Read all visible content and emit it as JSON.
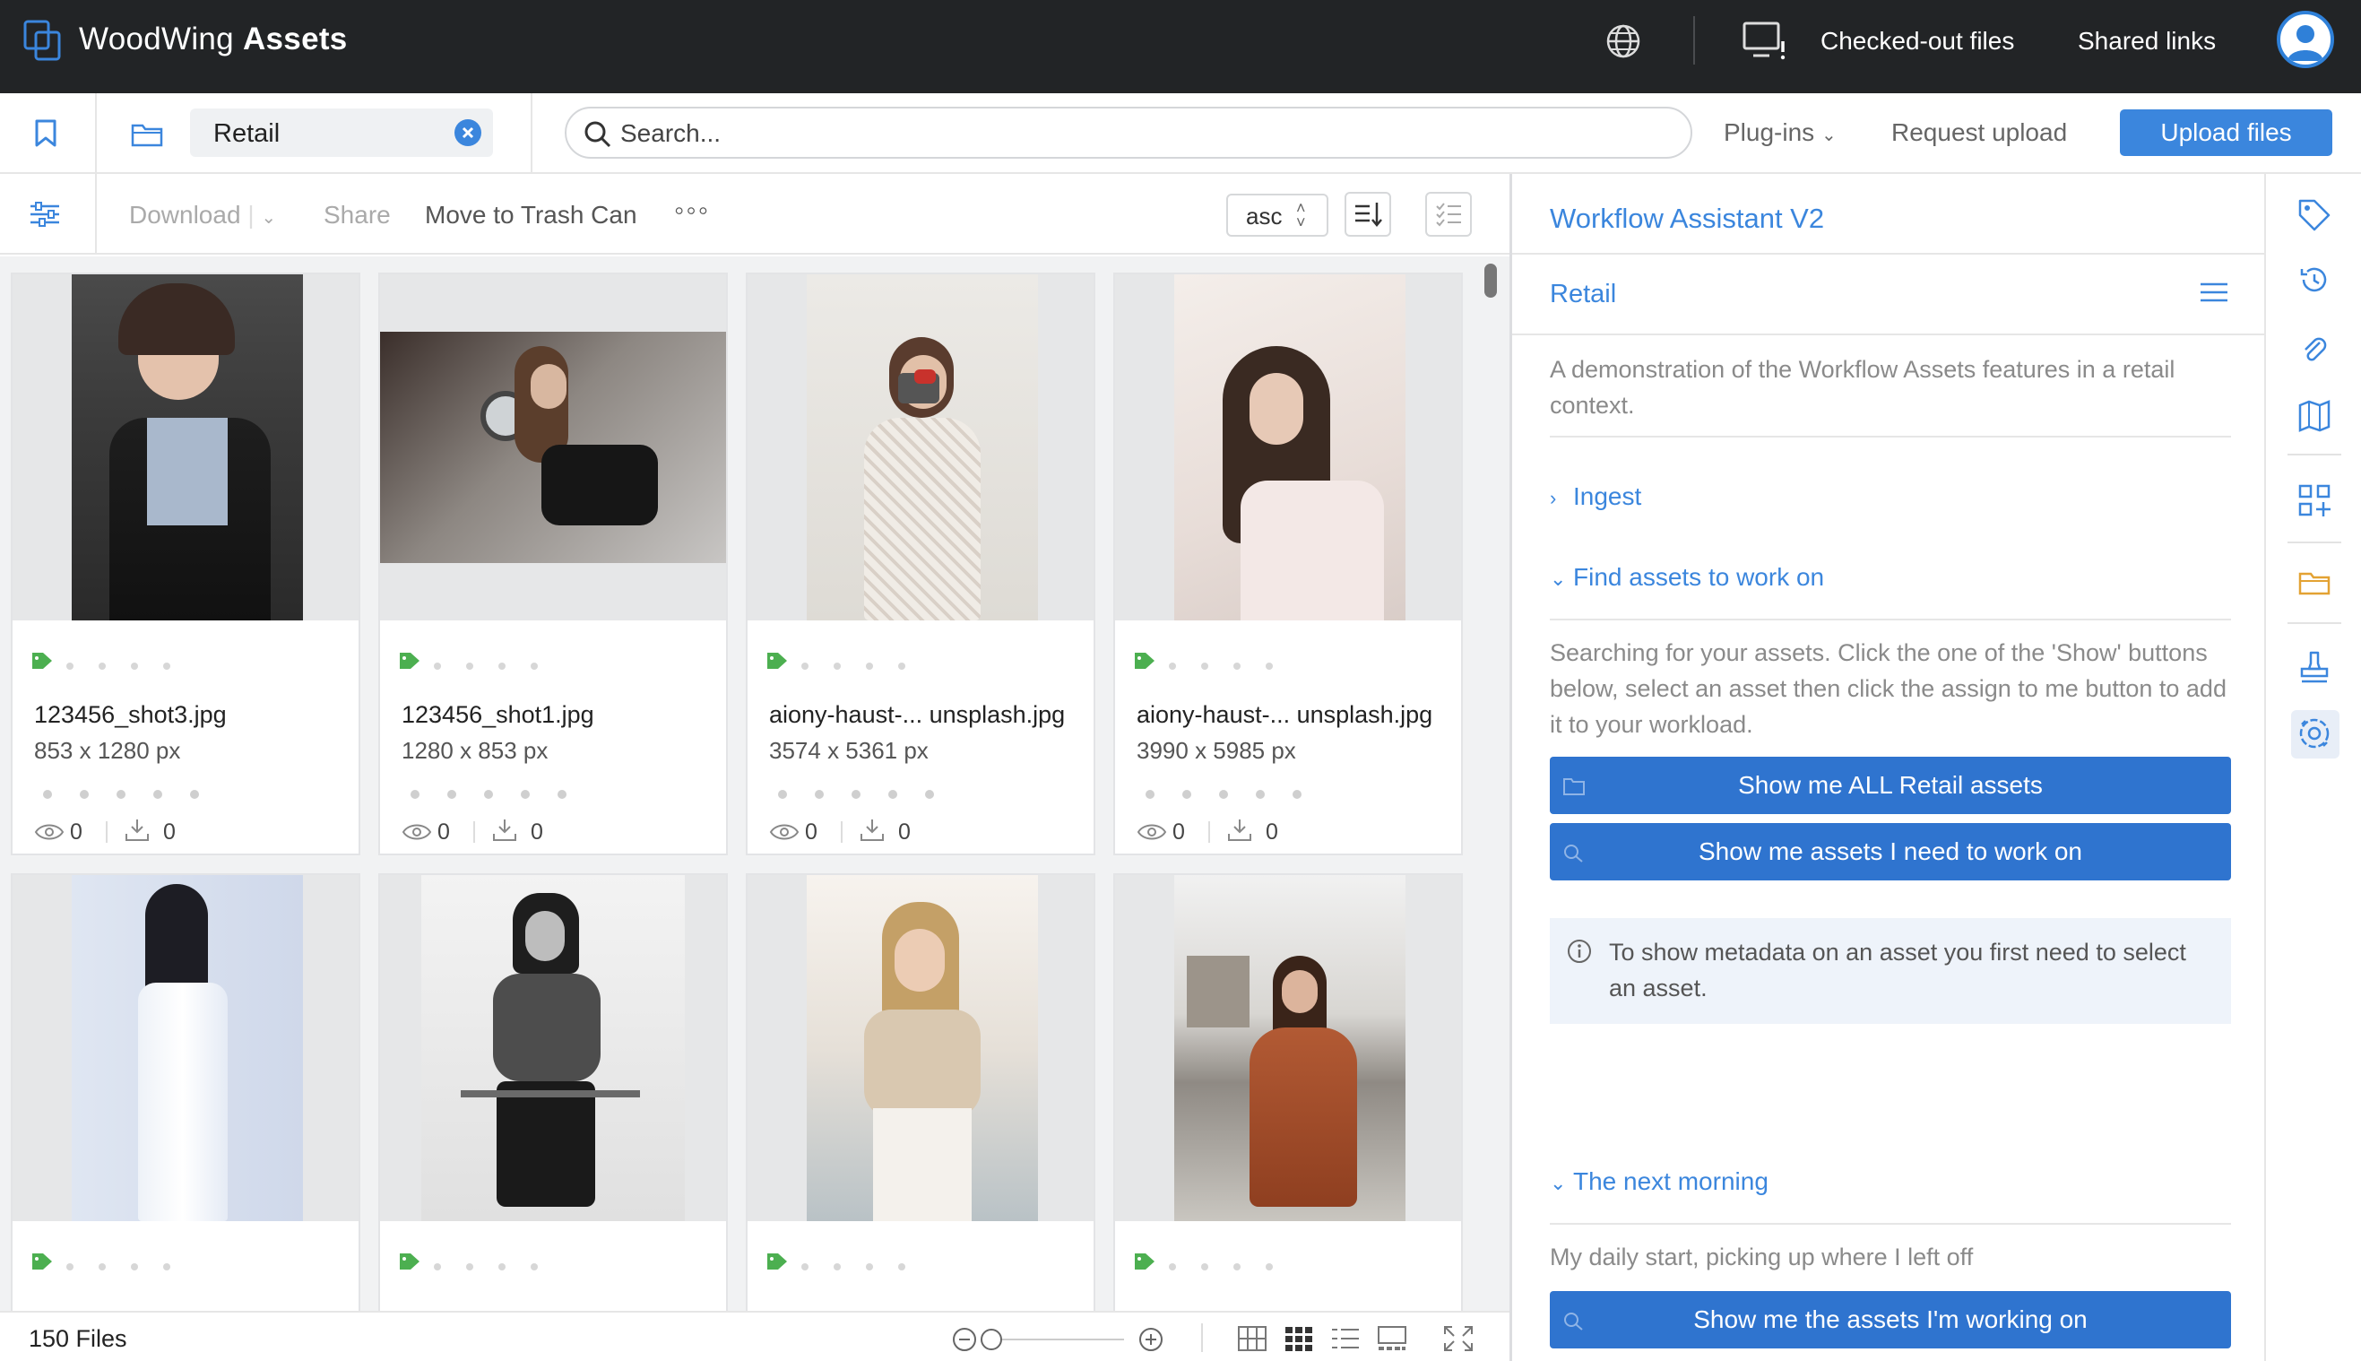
{
  "app": {
    "name_light": "WoodWing ",
    "name_bold": "Assets"
  },
  "topbar": {
    "checked_out_label": "Checked-out files",
    "shared_links_label": "Shared links"
  },
  "secondbar": {
    "folder_chip": "Retail",
    "search_placeholder": "Search...",
    "plugins_label": "Plug-ins",
    "request_upload_label": "Request upload",
    "upload_label": "Upload files"
  },
  "toolbar": {
    "download_label": "Download",
    "share_label": "Share",
    "trash_label": "Move to Trash Can",
    "more_label": "◦◦◦",
    "sort_value": "asc"
  },
  "assets": [
    {
      "name": "123456_shot3.jpg",
      "size": "853 x 1280 px",
      "views": "0",
      "downloads": "0"
    },
    {
      "name": "123456_shot1.jpg",
      "size": "1280 x 853 px",
      "views": "0",
      "downloads": "0"
    },
    {
      "name": "aiony-haust-... unsplash.jpg",
      "size": "3574 x 5361 px",
      "views": "0",
      "downloads": "0"
    },
    {
      "name": "aiony-haust-... unsplash.jpg",
      "size": "3990 x 5985 px",
      "views": "0",
      "downloads": "0"
    },
    {
      "name": "",
      "size": "",
      "views": "",
      "downloads": ""
    },
    {
      "name": "",
      "size": "",
      "views": "",
      "downloads": ""
    },
    {
      "name": "",
      "size": "",
      "views": "",
      "downloads": ""
    },
    {
      "name": "",
      "size": "",
      "views": "",
      "downloads": ""
    }
  ],
  "status": {
    "files_count": "150 Files"
  },
  "panel": {
    "title": "Workflow Assistant V2",
    "section": "Retail",
    "description": "A demonstration of the Workflow Assets features in a retail context.",
    "ingest_label": "Ingest",
    "find_label": "Find assets to work on",
    "find_desc": "Searching for your assets. Click the one of the 'Show' buttons below, select an asset then click the assign to me button to add it to your workload.",
    "btn_all": "Show me ALL Retail assets",
    "btn_need": "Show me assets I need to work on",
    "info_text": "To show metadata on an asset you first need to select an asset.",
    "morning_label": "The next morning",
    "morning_desc": "My daily start, picking up where I left off",
    "btn_working": "Show me the assets I'm working on"
  },
  "colors": {
    "accent": "#3b86dd",
    "button": "#2f74cf",
    "topbar": "#222426",
    "tag": "#4caf50"
  }
}
